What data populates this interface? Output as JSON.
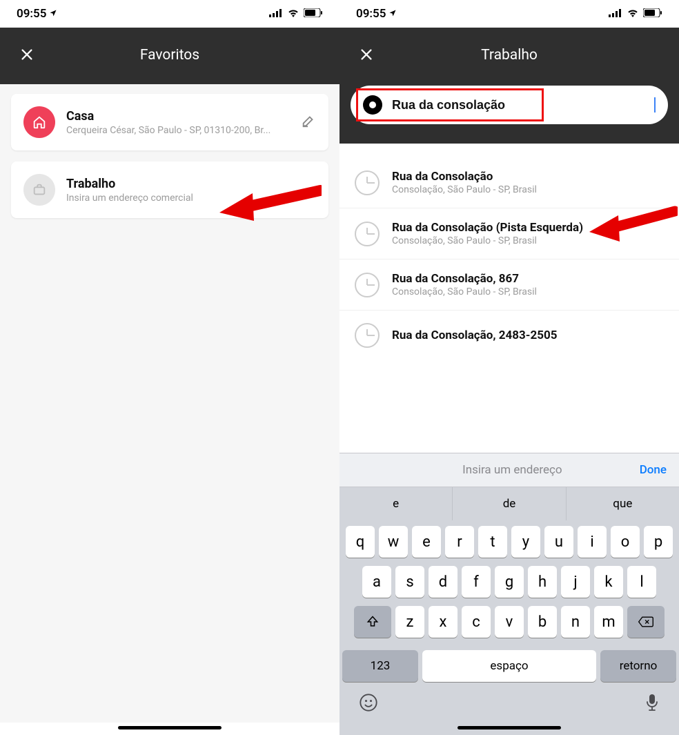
{
  "status": {
    "time": "09:55"
  },
  "left": {
    "title": "Favoritos",
    "items": [
      {
        "title": "Casa",
        "subtitle": "Cerqueira César, São Paulo - SP, 01310-200, Br...",
        "icon": "home",
        "editable": true
      },
      {
        "title": "Trabalho",
        "subtitle": "Insira um endereço comercial",
        "icon": "work",
        "editable": false
      }
    ]
  },
  "right": {
    "title": "Trabalho",
    "search_value": "Rua da consolação",
    "results": [
      {
        "title": "Rua da Consolação",
        "subtitle": "Consolação, São Paulo - SP, Brasil"
      },
      {
        "title": "Rua da Consolação (Pista Esquerda)",
        "subtitle": "Consolação, São Paulo - SP, Brasil"
      },
      {
        "title": "Rua da Consolação, 867",
        "subtitle": "Consolação, São Paulo - SP, Brasil"
      },
      {
        "title": "Rua da Consolação, 2483-2505",
        "subtitle": ""
      }
    ],
    "keyboard": {
      "hint": "Insira um endereço",
      "done": "Done",
      "suggestions": [
        "e",
        "de",
        "que"
      ],
      "row1": [
        "q",
        "w",
        "e",
        "r",
        "t",
        "y",
        "u",
        "i",
        "o",
        "p"
      ],
      "row2": [
        "a",
        "s",
        "d",
        "f",
        "g",
        "h",
        "j",
        "k",
        "l"
      ],
      "row3": [
        "z",
        "x",
        "c",
        "v",
        "b",
        "n",
        "m"
      ],
      "numkey": "123",
      "space": "espaço",
      "return": "retorno"
    }
  }
}
